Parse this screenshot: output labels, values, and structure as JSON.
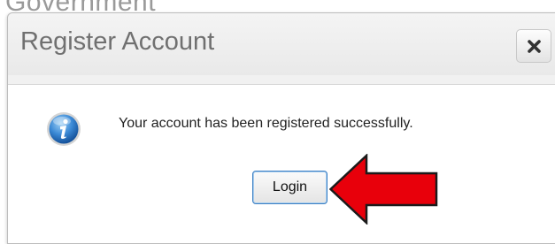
{
  "background": {
    "partial_text": "Government"
  },
  "dialog": {
    "title": "Register Account",
    "close_icon": "close-x-icon",
    "info_icon": "info-icon",
    "message": "Your account has been registered successfully.",
    "login_label": "Login"
  },
  "annotation": {
    "arrow_icon": "red-arrow-icon",
    "arrow_color": "#e8000b"
  },
  "colors": {
    "dialog_background": "#f1f1f1",
    "title_text": "#707070",
    "button_focus_border": "#3d80c4"
  }
}
